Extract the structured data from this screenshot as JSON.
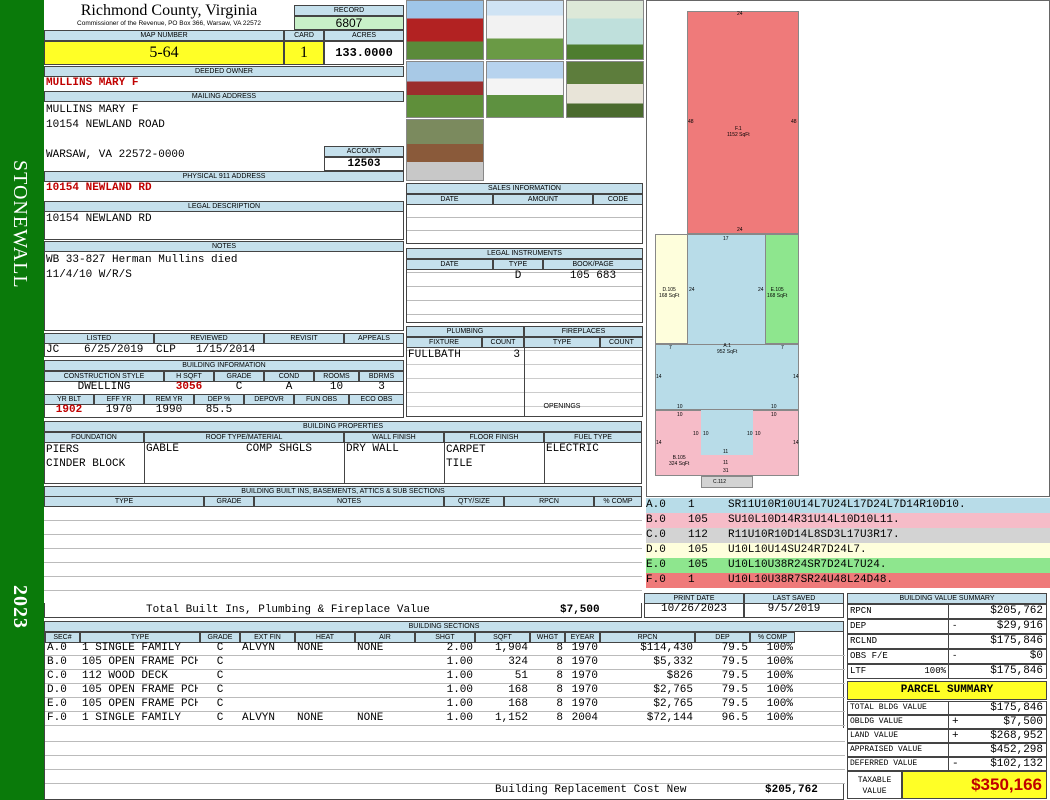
{
  "county": {
    "name": "Richmond County, Virginia",
    "commissioner": "Commissioner of the Revenue, PO Box 366, Warsaw, VA 22572"
  },
  "side": {
    "district": "STONEWALL",
    "year": "2023"
  },
  "record": {
    "label": "RECORD",
    "value": "6807"
  },
  "map": {
    "label": "MAP NUMBER",
    "value": "5-64"
  },
  "card": {
    "label": "CARD",
    "value": "1"
  },
  "acres": {
    "label": "ACRES",
    "value": "133.0000"
  },
  "deeded": {
    "label": "DEEDED OWNER",
    "value": "MULLINS MARY F"
  },
  "mailing": {
    "label": "MAILING ADDRESS",
    "line1": "MULLINS MARY F",
    "line2": "10154 NEWLAND ROAD",
    "line3": "WARSAW, VA 22572-0000"
  },
  "account": {
    "label": "ACCOUNT",
    "value": "12503"
  },
  "physical": {
    "label": "PHYSICAL 911 ADDRESS",
    "value": "10154 NEWLAND RD"
  },
  "legal": {
    "label": "LEGAL DESCRIPTION",
    "value": "10154 NEWLAND RD"
  },
  "notes": {
    "label": "NOTES",
    "line1": "WB 33-827 Herman Mullins died",
    "line2": "11/4/10 W/R/S"
  },
  "listed": {
    "listed_label": "LISTED",
    "reviewed_label": "REVIEWED",
    "revisit_label": "REVISIT",
    "appeals_label": "APPEALS",
    "listed_by": "JC",
    "listed_date": "6/25/2019",
    "reviewed_by": "CLP",
    "reviewed_date": "1/15/2014"
  },
  "binfo": {
    "label": "BUILDING INFORMATION",
    "h": [
      "CONSTRUCTION STYLE",
      "H SQFT",
      "GRADE",
      "COND",
      "ROOMS",
      "BDRMS"
    ],
    "v": [
      "DWELLING",
      "3056",
      "C",
      "A",
      "10",
      "3"
    ],
    "h2": [
      "YR BLT",
      "EFF YR",
      "REM YR",
      "DEP %",
      "DEPOVR",
      "FUN OBS",
      "ECO OBS"
    ],
    "v2": [
      "1902",
      "1970",
      "1990",
      "85.5",
      "",
      "",
      ""
    ]
  },
  "bprops": {
    "label": "BUILDING PROPERTIES",
    "h": [
      "FOUNDATION",
      "ROOF TYPE/MATERIAL",
      "WALL FINISH",
      "FLOOR FINISH",
      "FUEL TYPE"
    ],
    "foundation1": "PIERS",
    "foundation2": "CINDER BLOCK",
    "roof1": "GABLE",
    "roof2": "COMP SHGLS",
    "wall": "DRY WALL",
    "floor1": "CARPET",
    "floor2": "TILE",
    "fuel": "ELECTRIC"
  },
  "builtins": {
    "label": "BUILDING BUILT INS, BASEMENTS, ATTICS & SUB SECTIONS",
    "h": [
      "TYPE",
      "GRADE",
      "NOTES",
      "QTY/SIZE",
      "RPCN",
      "% COMP"
    ],
    "total_label": "Total Built Ins, Plumbing & Fireplace Value",
    "total": "$7,500"
  },
  "sales": {
    "label": "SALES INFORMATION",
    "h": [
      "DATE",
      "AMOUNT",
      "CODE"
    ]
  },
  "instruments": {
    "label": "LEGAL INSTRUMENTS",
    "h": [
      "DATE",
      "TYPE",
      "BOOK/PAGE"
    ],
    "type": "D",
    "bookpage": "105 683"
  },
  "plumbing": {
    "label": "PLUMBING",
    "h": [
      "FIXTURE",
      "COUNT"
    ],
    "fixture": "FULLBATH",
    "count": "3"
  },
  "fireplaces": {
    "label": "FIREPLACES",
    "h": [
      "TYPE",
      "COUNT"
    ],
    "openings": "OPENINGS"
  },
  "sketch": {
    "a": {
      "label": "A.1",
      "sqft": "952 SqFt"
    },
    "b": {
      "label": "B.105",
      "sqft": "324 SqFt"
    },
    "c": {
      "label": "C.112"
    },
    "d": {
      "label": "D.105",
      "sqft": "168 SqFt"
    },
    "e": {
      "label": "E.105",
      "sqft": "168 SqFt"
    },
    "f": {
      "label": "F.1",
      "sqft": "1152 SqFt"
    },
    "dims": {
      "f_top": "24",
      "f_left": "48",
      "f_right": "48",
      "f_bottom": "24",
      "a_top": "17",
      "d_left": "24",
      "e_right": "24",
      "d_in": "24",
      "e_in": "24",
      "a_l7": "7",
      "a_r7": "7",
      "a_l14": "14",
      "a_r14": "14",
      "a_l10": "10",
      "a_r10": "10",
      "b_l10": "10",
      "b_r10": "10",
      "b_m10a": "10",
      "b_m10b": "10",
      "b_l14": "14",
      "b_r14": "14",
      "b_m11": "11",
      "b_b11": "11",
      "b_b31": "31",
      "a_i10a": "10",
      "a_i10b": "10"
    }
  },
  "legend": [
    {
      "code": "A.0",
      "n": "1",
      "path": "SR11U10R10U14L7U24L17D24L7D14R10D10.",
      "color": "#b8dce8"
    },
    {
      "code": "B.0",
      "n": "105",
      "path": "SU10L10D14R31U14L10D10L11.",
      "color": "#f6bcc8"
    },
    {
      "code": "C.0",
      "n": "112",
      "path": "R11U10R10D14L8SD3L17U3R17.",
      "color": "#d3d3d3"
    },
    {
      "code": "D.0",
      "n": "105",
      "path": "U10L10U14SU24R7D24L7.",
      "color": "#fefedc"
    },
    {
      "code": "E.0",
      "n": "105",
      "path": "U10L10U38R24SR7D24L7U24.",
      "color": "#8ee68e"
    },
    {
      "code": "F.0",
      "n": "1",
      "path": "U10L10U38R7SR24U48L24D48.",
      "color": "#ef7a7a"
    }
  ],
  "print": {
    "print_label": "PRINT DATE",
    "saved_label": "LAST SAVED",
    "print_date": "10/26/2023",
    "saved_date": "9/5/2019"
  },
  "bsections": {
    "label": "BUILDING SECTIONS",
    "h": [
      "SEC#",
      "TYPE",
      "GRADE",
      "EXT FIN",
      "HEAT",
      "AIR",
      "SHGT",
      "SQFT",
      "WHGT",
      "EYEAR",
      "RPCN",
      "DEP",
      "% COMP"
    ],
    "rows": [
      [
        "A.0",
        "1 SINGLE FAMILY",
        "C",
        "ALVYN",
        "NONE",
        "NONE",
        "2.00",
        "1,904",
        "8",
        "1970",
        "$114,430",
        "79.5",
        "100%"
      ],
      [
        "B.0",
        "105 OPEN FRAME PCH",
        "C",
        "",
        "",
        "",
        "1.00",
        "324",
        "8",
        "1970",
        "$5,332",
        "79.5",
        "100%"
      ],
      [
        "C.0",
        "112 WOOD DECK",
        "C",
        "",
        "",
        "",
        "1.00",
        "51",
        "8",
        "1970",
        "$826",
        "79.5",
        "100%"
      ],
      [
        "D.0",
        "105 OPEN FRAME PCH",
        "C",
        "",
        "",
        "",
        "1.00",
        "168",
        "8",
        "1970",
        "$2,765",
        "79.5",
        "100%"
      ],
      [
        "E.0",
        "105 OPEN FRAME PCH",
        "C",
        "",
        "",
        "",
        "1.00",
        "168",
        "8",
        "1970",
        "$2,765",
        "79.5",
        "100%"
      ],
      [
        "F.0",
        "1 SINGLE FAMILY",
        "C",
        "ALVYN",
        "NONE",
        "NONE",
        "1.00",
        "1,152",
        "8",
        "2004",
        "$72,144",
        "96.5",
        "100%"
      ]
    ],
    "replacement_label": "Building Replacement Cost New",
    "replacement": "$205,762"
  },
  "bvs": {
    "label": "BUILDING VALUE SUMMARY",
    "rows": [
      {
        "k": "RPCN",
        "s": "",
        "v": "$205,762"
      },
      {
        "k": "DEP",
        "s": "-",
        "v": "$29,916"
      },
      {
        "k": "RCLND",
        "s": "",
        "v": "$175,846"
      },
      {
        "k": "OBS F/E",
        "s": "-",
        "v": "$0"
      },
      {
        "k": "LTF",
        "pct": "100%",
        "s": "",
        "v": "$175,846"
      }
    ]
  },
  "ps": {
    "label": "PARCEL SUMMARY",
    "rows": [
      {
        "k": "TOTAL BLDG VALUE",
        "s": "",
        "v": "$175,846"
      },
      {
        "k": "OBLDG VALUE",
        "s": "+",
        "v": "$7,500"
      },
      {
        "k": "LAND VALUE",
        "s": "+",
        "v": "$268,952"
      },
      {
        "k": "APPRAISED VALUE",
        "s": "",
        "v": "$452,298"
      },
      {
        "k": "DEFERRED VALUE",
        "s": "-",
        "v": "$102,132"
      }
    ],
    "taxable_label1": "TAXABLE",
    "taxable_label2": "VALUE",
    "taxable": "$350,166"
  }
}
